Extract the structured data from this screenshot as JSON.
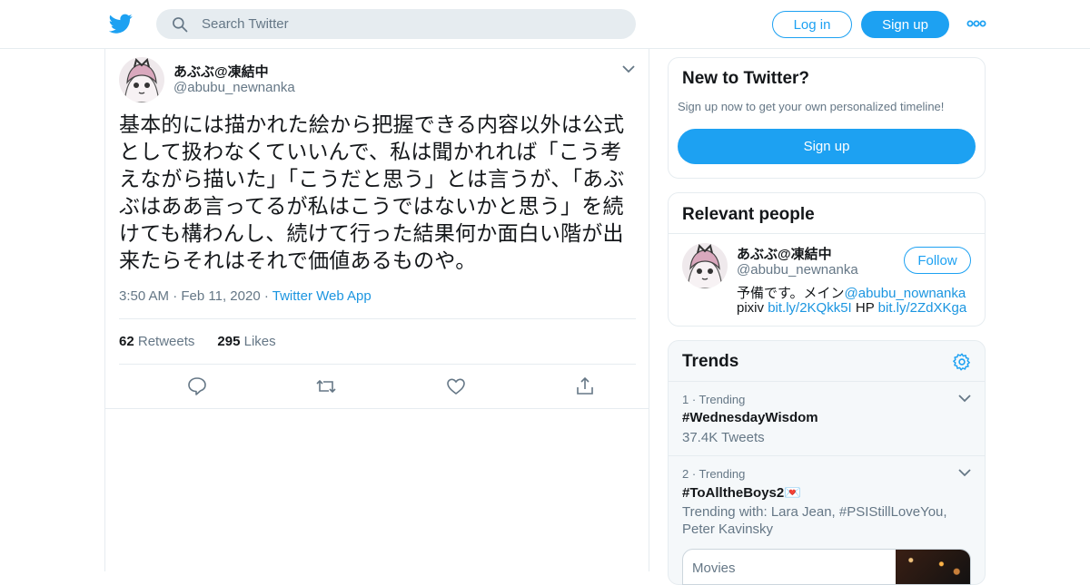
{
  "header": {
    "search_placeholder": "Search Twitter",
    "login_label": "Log in",
    "signup_label": "Sign up",
    "icons": [
      "twitter-bird-icon",
      "search-icon",
      "more-dots-icon"
    ],
    "accent_color": "#1da1f2"
  },
  "tweet": {
    "display_name": "あぶぶ@凍結中",
    "handle": "@abubu_newnanka",
    "text": "基本的には描かれた絵から把握できる内容以外は公式として扱わなくていいんで、私は聞かれれば「こう考えながら描いた」「こうだと思う」とは言うが、「あぶぶはああ言ってるが私はこうではないかと思う」を続けても構わんし、続けて行った結果何か面白い階が出来たらそれはそれで価値あるものや。",
    "time": "3:50 AM",
    "date": "Feb 11, 2020",
    "source": "Twitter Web App",
    "retweets_count": "62",
    "retweets_label": "Retweets",
    "likes_count": "295",
    "likes_label": "Likes",
    "action_icons": [
      "reply-icon",
      "retweet-icon",
      "like-icon",
      "share-icon"
    ]
  },
  "sidebar": {
    "new_to_twitter": {
      "title": "New to Twitter?",
      "subtitle": "Sign up now to get your own personalized timeline!",
      "signup_label": "Sign up"
    },
    "relevant_people": {
      "title": "Relevant people",
      "person": {
        "display_name": "あぶぶ@凍結中",
        "handle": "@abubu_newnanka",
        "follow_label": "Follow",
        "bio_text1": "予備です。メイン",
        "bio_link1": "@abubu_nownanka",
        "bio_text2": "pixiv ",
        "bio_link2": "bit.ly/2KQkk5I",
        "bio_text3": " HP ",
        "bio_link3": "bit.ly/2ZdXKga"
      }
    },
    "trends": {
      "title": "Trends",
      "items": [
        {
          "rank": "1 · Trending",
          "tag": "#WednesdayWisdom",
          "detail": "37.4K Tweets"
        },
        {
          "rank": "2 · Trending",
          "tag": "#ToAlltheBoys2💌",
          "detail": "Trending with: Lara Jean, #PSIStillLoveYou, Peter Kavinsky"
        }
      ],
      "card_label": "Movies"
    }
  }
}
